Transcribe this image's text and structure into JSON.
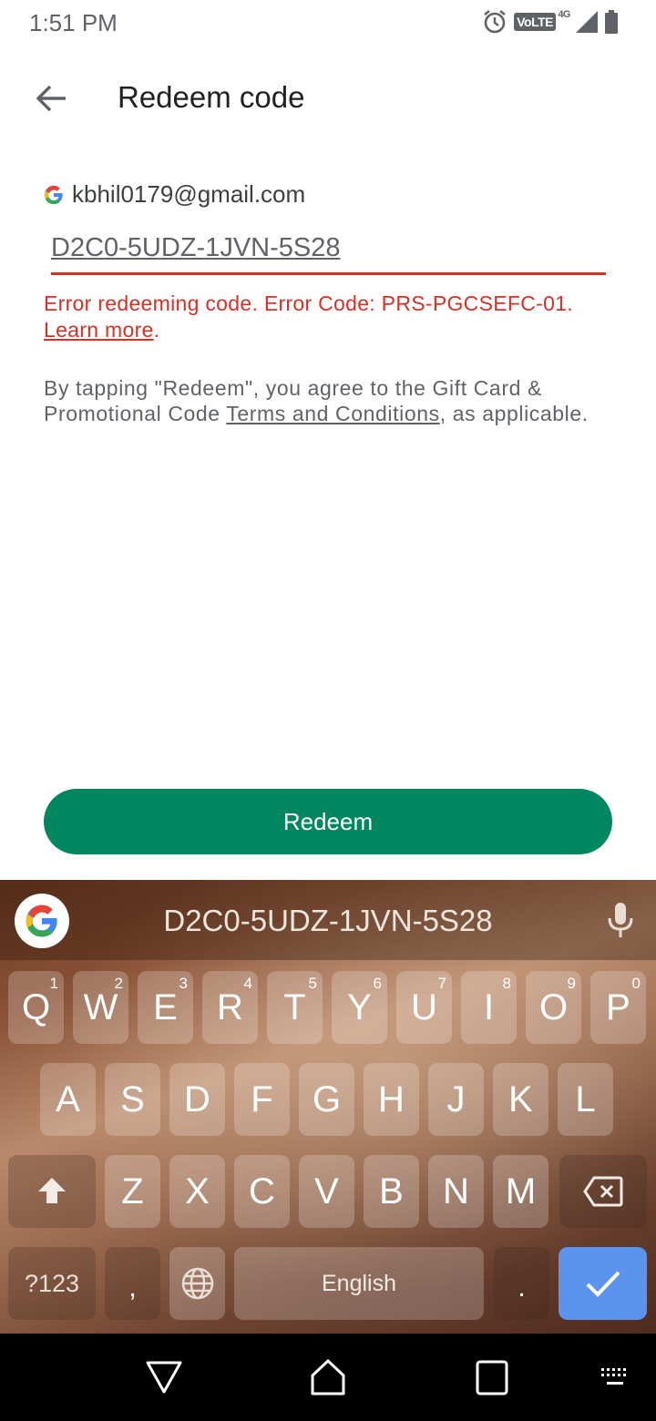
{
  "status_bar": {
    "time": "1:51 PM",
    "volte_label": "VoLTE",
    "network_label": "4G",
    "icons": [
      "alarm-icon",
      "volte-icon",
      "signal-icon",
      "battery-icon"
    ]
  },
  "app_bar": {
    "back_icon": "arrow-left-icon",
    "title": "Redeem code"
  },
  "account": {
    "icon": "google-g-icon",
    "email": "kbhil0179@gmail.com"
  },
  "code_field": {
    "value": "D2C0-5UDZ-1JVN-5S28",
    "underline_color": "#d93025"
  },
  "error": {
    "message": "Error redeeming code. Error Code: PRS-PGCSEFC-01.",
    "link": "Learn more",
    "suffix": ".",
    "color": "#d93025"
  },
  "terms": {
    "prefix": "By tapping \"Redeem\", you agree to the Gift Card & Promotional Code ",
    "link": "Terms and Conditions",
    "suffix": ", as applicable."
  },
  "redeem_button": {
    "label": "Redeem",
    "color": "#01875f"
  },
  "keyboard": {
    "suggestion": "D2C0-5UDZ-1JVN-5S28",
    "row1": [
      {
        "key": "Q",
        "hint": "1"
      },
      {
        "key": "W",
        "hint": "2"
      },
      {
        "key": "E",
        "hint": "3"
      },
      {
        "key": "R",
        "hint": "4"
      },
      {
        "key": "T",
        "hint": "5"
      },
      {
        "key": "Y",
        "hint": "6"
      },
      {
        "key": "U",
        "hint": "7"
      },
      {
        "key": "I",
        "hint": "8"
      },
      {
        "key": "O",
        "hint": "9"
      },
      {
        "key": "P",
        "hint": "0"
      }
    ],
    "row2": [
      "A",
      "S",
      "D",
      "F",
      "G",
      "H",
      "J",
      "K",
      "L"
    ],
    "row3": [
      "Z",
      "X",
      "C",
      "V",
      "B",
      "N",
      "M"
    ],
    "symbols_label": "?123",
    "comma_label": ",",
    "space_label": "English",
    "period_label": ".",
    "enter_color": "#5b93ef"
  },
  "nav_bar": {
    "buttons": [
      "back-triangle-icon",
      "home-icon",
      "recents-icon",
      "keyboard-switch-icon"
    ]
  }
}
